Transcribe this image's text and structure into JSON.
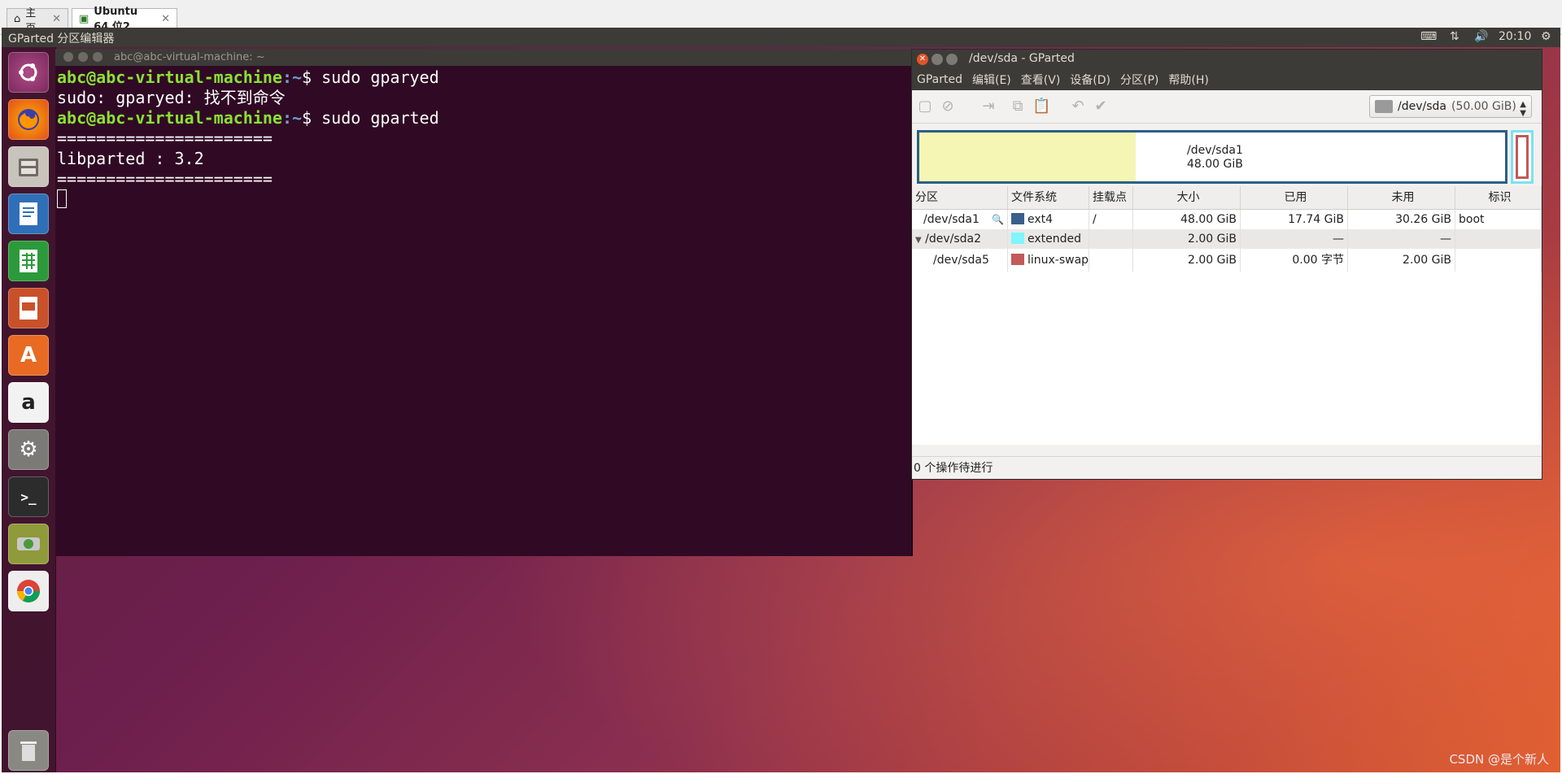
{
  "host": {
    "tabs": [
      {
        "label": "主页",
        "active": false
      },
      {
        "label": "Ubuntu 64 位2",
        "active": true
      }
    ]
  },
  "topbar": {
    "app_title": "GParted 分区编辑器",
    "time": "20:10"
  },
  "launcher": {
    "items": [
      "ubuntu-dash",
      "firefox",
      "files",
      "libreoffice-writer",
      "libreoffice-calc",
      "libreoffice-impress",
      "software-center",
      "amazon",
      "system-settings",
      "terminal",
      "gparted",
      "chrome",
      "trash"
    ]
  },
  "terminal": {
    "title": "abc@abc-virtual-machine: ~",
    "prompt_user": "abc@abc-virtual-machine",
    "prompt_path": ":~",
    "prompt_symbol": "$",
    "lines": {
      "cmd1": " sudo gparyed",
      "out1": "sudo: gparyed: 找不到命令",
      "cmd2": " sudo gparted",
      "sep1": "======================",
      "out2": "libparted : 3.2",
      "sep2": "======================"
    }
  },
  "gparted": {
    "title": "/dev/sda - GParted",
    "menu": [
      "GParted",
      "编辑(E)",
      "查看(V)",
      "设备(D)",
      "分区(P)",
      "帮助(H)"
    ],
    "device": {
      "name": "/dev/sda",
      "size": "(50.00 GiB)"
    },
    "map": {
      "label": "/dev/sda1",
      "size": "48.00 GiB",
      "used_fraction": 0.37
    },
    "columns": [
      "分区",
      "文件系统",
      "挂载点",
      "大小",
      "已用",
      "未用",
      "标识"
    ],
    "rows": [
      {
        "partition": "/dev/sda1",
        "filesystem": "ext4",
        "color": "#3a5f8a",
        "mount": "/",
        "size": "48.00 GiB",
        "used": "17.74 GiB",
        "unused": "30.26 GiB",
        "flags": "boot"
      },
      {
        "partition": "/dev/sda2",
        "filesystem": "extended",
        "color": "#7ef5ff",
        "mount": "",
        "size": "2.00 GiB",
        "used": "—",
        "unused": "—",
        "flags": ""
      },
      {
        "partition": "/dev/sda5",
        "filesystem": "linux-swap",
        "color": "#c15a58",
        "mount": "",
        "size": "2.00 GiB",
        "used": "0.00 字节",
        "unused": "2.00 GiB",
        "flags": ""
      }
    ],
    "status": "0 个操作待进行"
  },
  "watermark": "CSDN @是个新人"
}
